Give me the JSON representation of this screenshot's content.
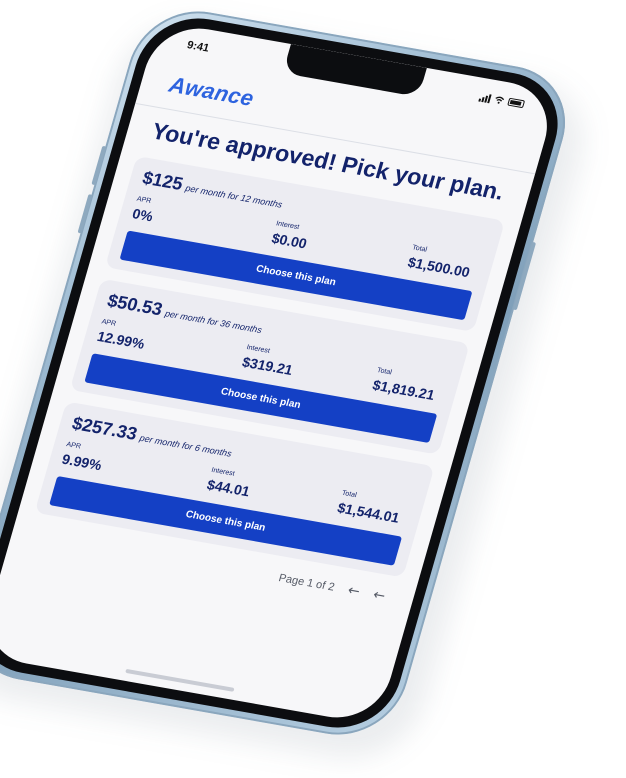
{
  "status": {
    "time": "9:41",
    "icons": [
      "signal-icon",
      "wifi-icon",
      "battery-icon"
    ]
  },
  "app": {
    "logo": "Awance",
    "brand_color": "#2d63df"
  },
  "page": {
    "heading": "You're approved! Pick your plan."
  },
  "plans": [
    {
      "amount": "$125",
      "term": "per month for 12 months",
      "apr_label": "APR",
      "apr": "0%",
      "interest_label": "Interest",
      "interest": "$0.00",
      "total_label": "Total",
      "total": "$1,500.00",
      "button": "Choose this plan"
    },
    {
      "amount": "$50.53",
      "term": "per month for 36 months",
      "apr_label": "APR",
      "apr": "12.99%",
      "interest_label": "Interest",
      "interest": "$319.21",
      "total_label": "Total",
      "total": "$1,819.21",
      "button": "Choose this plan"
    },
    {
      "amount": "$257.33",
      "term": "per month for 6 months",
      "apr_label": "APR",
      "apr": "9.99%",
      "interest_label": "Interest",
      "interest": "$44.01",
      "total_label": "Total",
      "total": "$1,544.01",
      "button": "Choose this plan"
    }
  ],
  "pager": {
    "text": "Page 1 of 2",
    "prev_icon": "←",
    "next_icon": "←"
  },
  "colors": {
    "primary_button": "#1440c5",
    "heading_text": "#13236b",
    "card_bg": "#ececf2"
  }
}
